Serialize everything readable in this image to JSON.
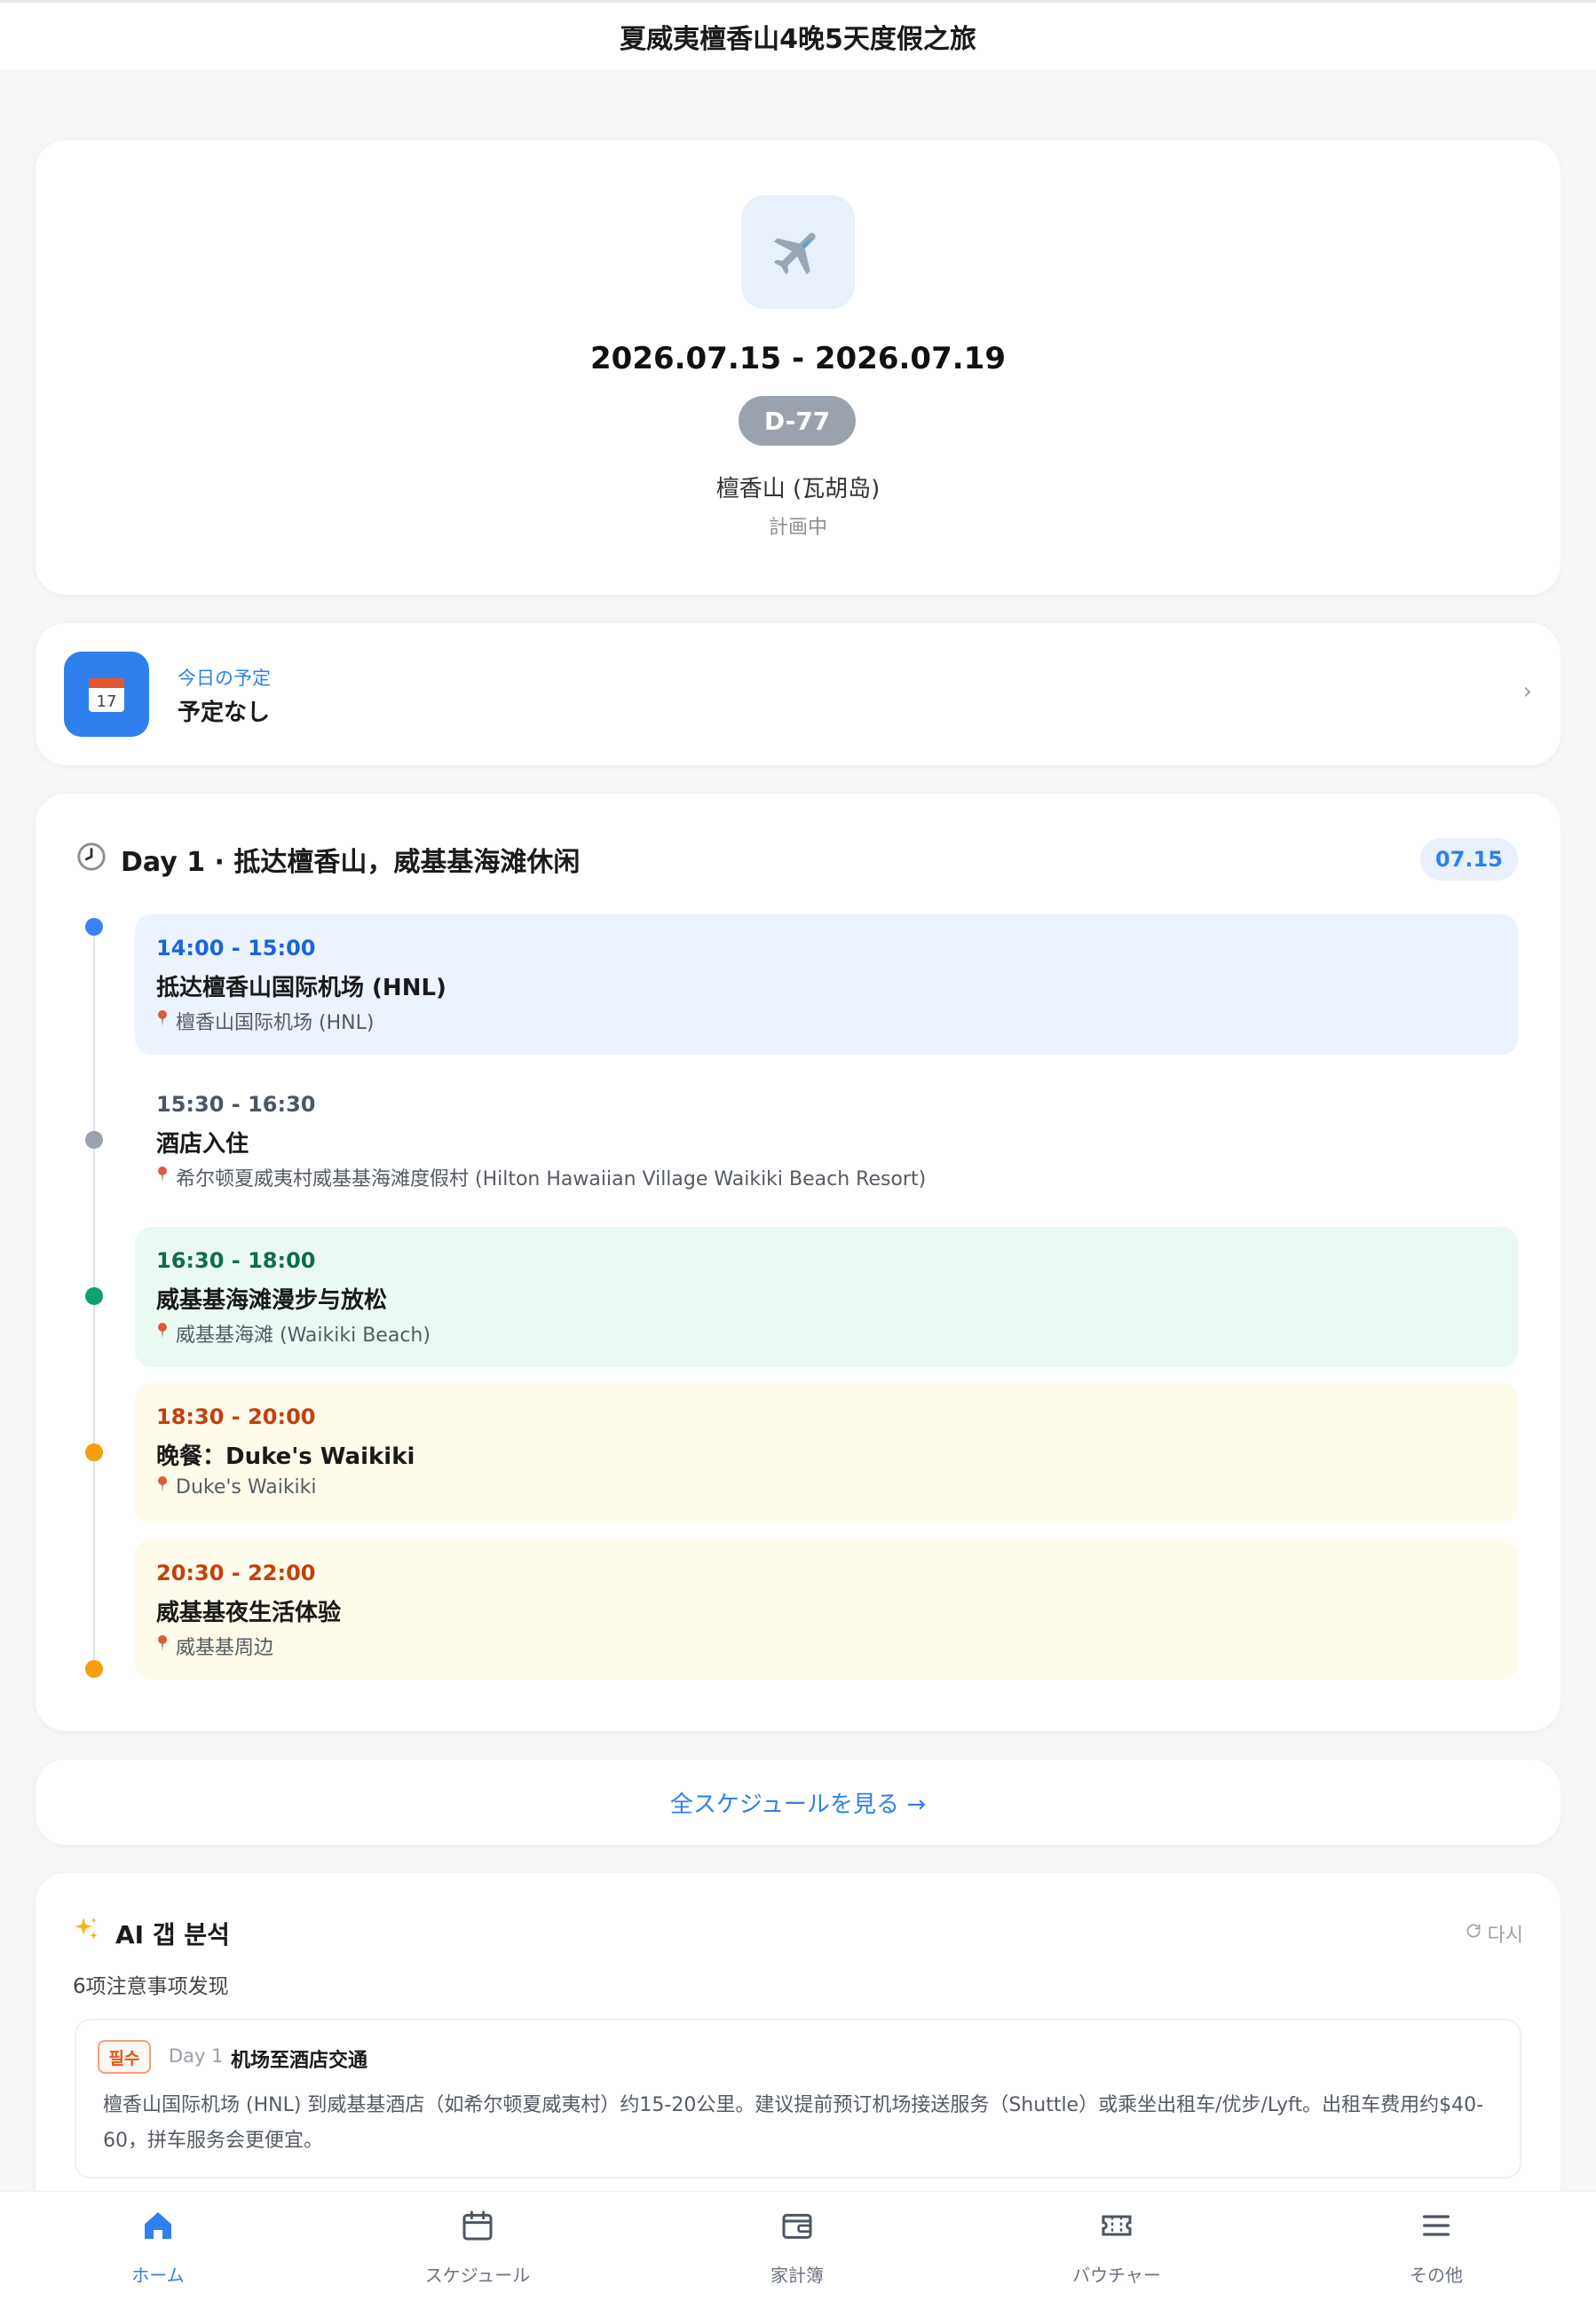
{
  "header": {
    "title": "夏威夷檀香山4晚5天度假之旅"
  },
  "hero": {
    "icon": "airplane-icon",
    "dates": "2026.07.15 - 2026.07.19",
    "dday": "D-77",
    "destination": "檀香山 (瓦胡岛)",
    "status": "計画中"
  },
  "today": {
    "icon": "calendar-icon",
    "calendar_day": "17",
    "label": "今日の予定",
    "value": "予定なし"
  },
  "day": {
    "icon": "clock-icon",
    "title": "Day 1 · 抵达檀香山，威基基海滩休闲",
    "date": "07.15",
    "events": [
      {
        "time": "14:00 - 15:00",
        "title": "抵达檀香山国际机场 (HNL)",
        "location": "檀香山国际机场 (HNL)",
        "color": "#1d64d8",
        "bg": "#ebf3fe",
        "dot": "#3b82f6"
      },
      {
        "time": "15:30 - 16:30",
        "title": "酒店入住",
        "location": "希尔顿夏威夷村威基基海滩度假村 (Hilton Hawaiian Village Waikiki Beach Resort)",
        "color": "#4b5563",
        "bg": "#ffffff",
        "dot": "#9aa3ad"
      },
      {
        "time": "16:30 - 18:00",
        "title": "威基基海滩漫步与放松",
        "location": "威基基海滩 (Waikiki Beach)",
        "color": "#0f6b52",
        "bg": "#eafaf3",
        "dot": "#10a072"
      },
      {
        "time": "18:30 - 20:00",
        "title": "晚餐：Duke's Waikiki",
        "location": "Duke's Waikiki",
        "color": "#c2410c",
        "bg": "#fefbeb",
        "dot": "#f59e0b"
      },
      {
        "time": "20:30 - 22:00",
        "title": "威基基夜生活体验",
        "location": "威基基周边",
        "color": "#c2410c",
        "bg": "#fefbeb",
        "dot": "#f59e0b"
      }
    ]
  },
  "see_all": {
    "label": "全スケジュールを見る →"
  },
  "ai": {
    "title": "AI 갭 분석",
    "retry": "다시",
    "summary": "6项注意事项发现",
    "item": {
      "badge": "필수",
      "day": "Day 1",
      "title": "机场至酒店交通",
      "desc": "檀香山国际机场 (HNL) 到威基基酒店（如希尔顿夏威夷村）约15-20公里。建议提前预订机场接送服务（Shuttle）或乘坐出租车/优步/Lyft。出租车费用约$40-60，拼车服务会更便宜。"
    }
  },
  "nav": {
    "items": [
      {
        "label": "ホーム",
        "icon": "home-icon"
      },
      {
        "label": "スケジュール",
        "icon": "calendar-icon"
      },
      {
        "label": "家計簿",
        "icon": "wallet-icon"
      },
      {
        "label": "バウチャー",
        "icon": "ticket-icon"
      },
      {
        "label": "その他",
        "icon": "menu-icon"
      }
    ]
  },
  "colors": {
    "accent": "#2f80ed"
  }
}
